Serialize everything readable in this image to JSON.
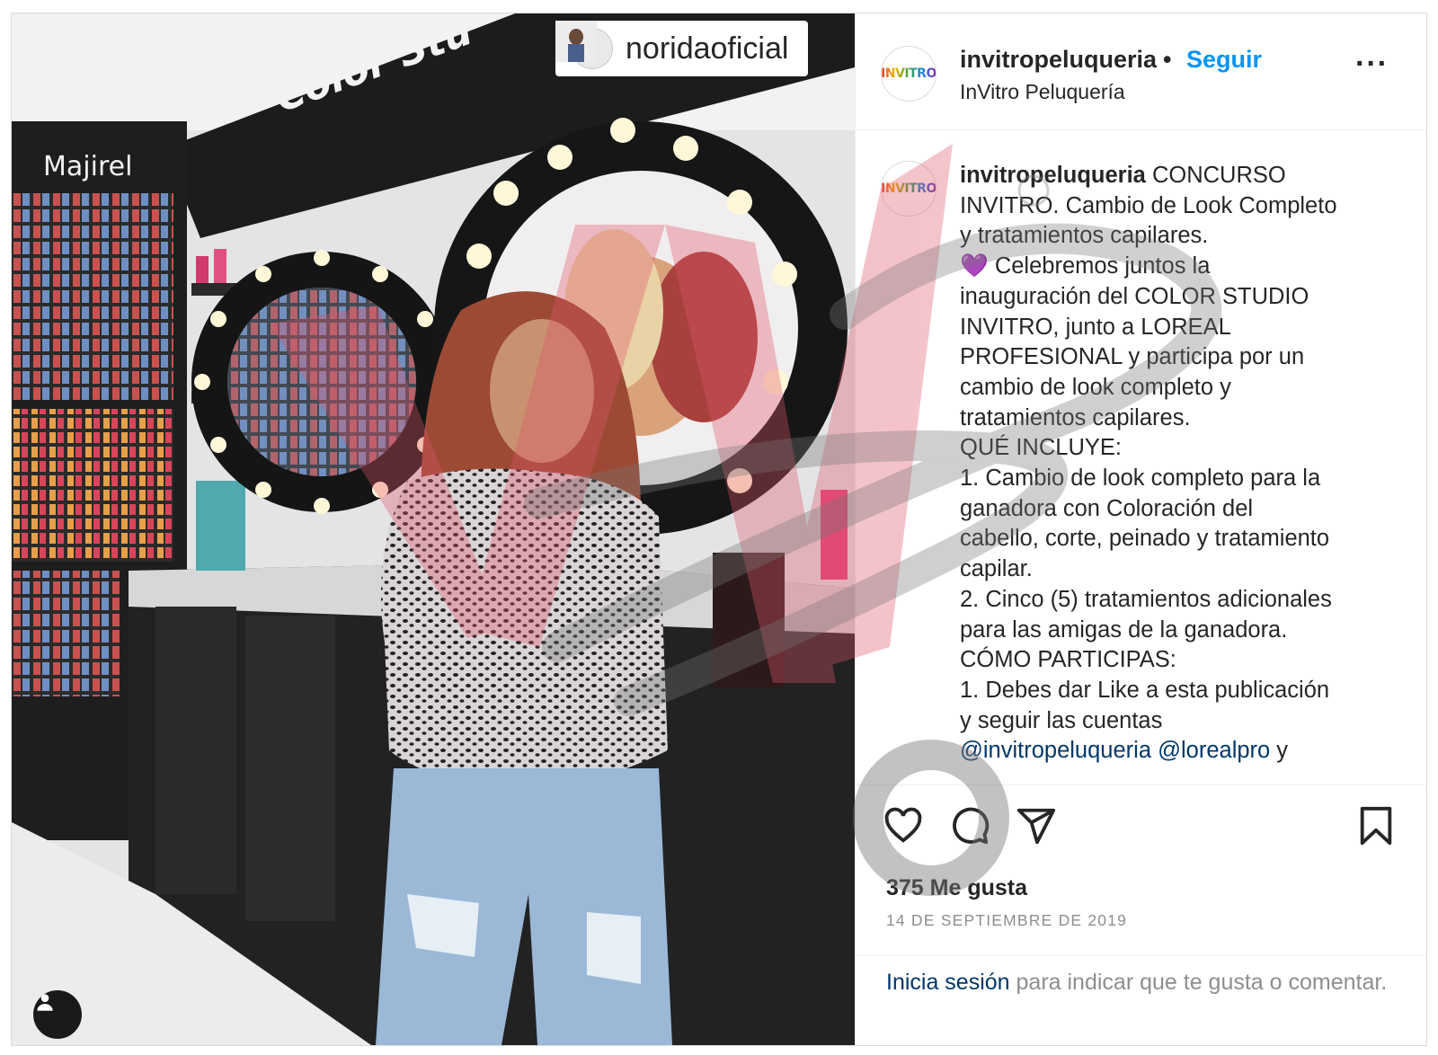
{
  "photo": {
    "repost_user": "noridaoficial",
    "store_sign_1": "Color Stu",
    "store_sign_2": "Majirel"
  },
  "header": {
    "avatar_text": "INVITRO",
    "username": "invitropeluqueria",
    "separator": "•",
    "follow_label": "Seguir",
    "full_name": "InVitro Peluquería",
    "more_label": "···"
  },
  "caption": {
    "username": "invitropeluqueria",
    "lines": [
      " CONCURSO",
      "INVITRO. Cambio de Look Completo",
      "y tratamientos capilares.",
      "💜 Celebremos juntos la",
      "inauguración del COLOR STUDIO",
      "INVITRO, junto a LOREAL",
      "PROFESIONAL y participa por un",
      "cambio de look completo y",
      "tratamientos capilares.",
      "QUÉ INCLUYE:",
      "1. Cambio de look completo para la",
      "ganadora con Coloración del",
      "cabello, corte, peinado y tratamiento",
      "capilar.",
      "2. Cinco (5) tratamientos adicionales",
      "para las amigas de la ganadora.",
      "CÓMO PARTICIPAS:",
      "1. Debes dar Like a esta publicación",
      "y seguir las cuentas"
    ],
    "mention_1": "@invitropeluqueria",
    "mention_2": "@lorealpro",
    "trailing": " y"
  },
  "actions": {
    "likes": "375 Me gusta",
    "date": "14 DE SEPTIEMBRE DE 2019"
  },
  "login": {
    "link": "Inicia sesión",
    "rest": " para indicar que te gusta o comentar."
  },
  "colors": {
    "link_blue": "#0095f6",
    "mention_blue": "#00376b",
    "muted_gray": "#8e8e8e",
    "watermark_red": "#e0566a"
  }
}
